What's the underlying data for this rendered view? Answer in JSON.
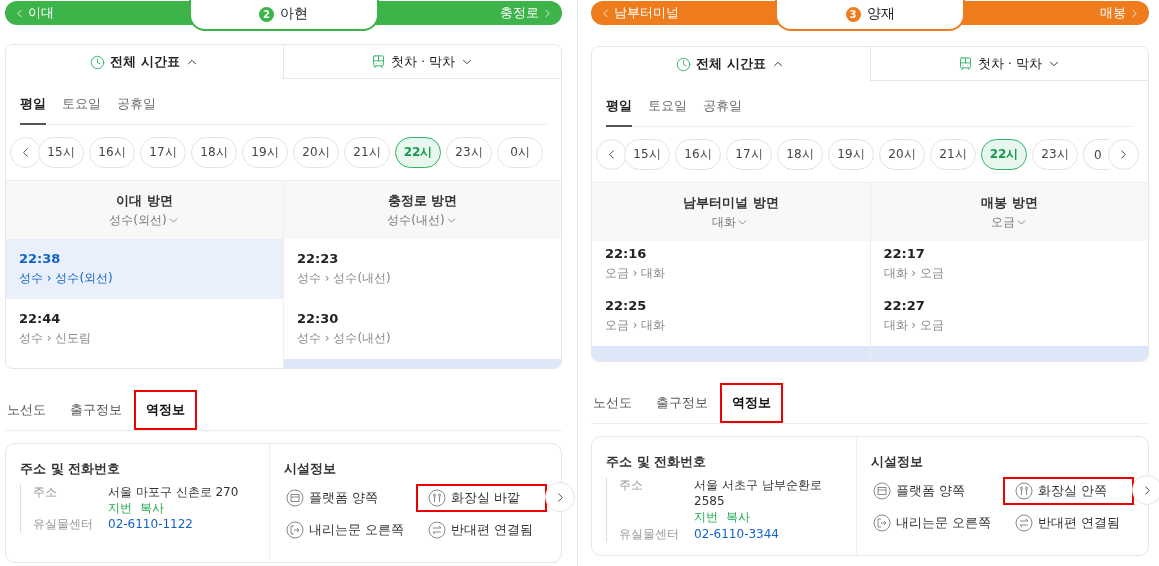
{
  "panels": [
    {
      "line": {
        "number": "2",
        "color": "#3cb44a",
        "prev": "이대",
        "current": "아현",
        "next": "충정로"
      },
      "view_tabs": [
        {
          "kind": "timetable",
          "label": "전체 시간표",
          "selected": true
        },
        {
          "kind": "first_last",
          "label": "첫차 · 막차",
          "selected": false
        }
      ],
      "day_tabs": [
        {
          "label": "평일",
          "selected": true
        },
        {
          "label": "토요일",
          "selected": false
        },
        {
          "label": "공휴일",
          "selected": false
        }
      ],
      "hours": [
        {
          "label": "15시",
          "selected": false
        },
        {
          "label": "16시",
          "selected": false
        },
        {
          "label": "17시",
          "selected": false
        },
        {
          "label": "18시",
          "selected": false
        },
        {
          "label": "19시",
          "selected": false
        },
        {
          "label": "20시",
          "selected": false
        },
        {
          "label": "21시",
          "selected": false
        },
        {
          "label": "22시",
          "selected": true
        },
        {
          "label": "23시",
          "selected": false
        },
        {
          "label": "0시",
          "selected": false
        }
      ],
      "scroll_next": false,
      "directions": [
        {
          "title": "이대 방면",
          "subtitle": "성수(외선)",
          "next_row_selected": false,
          "rows": [
            {
              "time": "22:38",
              "route": "성수 › 성수(외선)",
              "selected": true
            },
            {
              "time": "22:44",
              "route": "성수 › 신도림",
              "selected": false
            }
          ]
        },
        {
          "title": "충정로 방면",
          "subtitle": "성수(내선)",
          "next_row_selected": true,
          "rows": [
            {
              "time": "22:23",
              "route": "성수 › 성수(내선)",
              "selected": false
            },
            {
              "time": "22:30",
              "route": "성수 › 성수(내선)",
              "selected": false
            }
          ]
        }
      ],
      "info_tabs": [
        {
          "label": "노선도",
          "selected": false,
          "highlighted": false
        },
        {
          "label": "출구정보",
          "selected": false,
          "highlighted": false
        },
        {
          "label": "역정보",
          "selected": true,
          "highlighted": true
        }
      ],
      "address": {
        "title": "주소 및 전화번호",
        "address_label": "주소",
        "address": "서울 마포구 신촌로 270",
        "links": [
          "지번",
          "복사"
        ],
        "phone_label": "유실물센터",
        "phone": "02-6110-1122"
      },
      "facilities": {
        "title": "시설정보",
        "items": [
          {
            "kind": "platform",
            "label": "플랫폼 양쪽",
            "highlighted": false
          },
          {
            "kind": "toilet",
            "label": "화장실 바깥",
            "highlighted": true
          },
          {
            "kind": "door",
            "label": "내리는문 오른쪽",
            "highlighted": false
          },
          {
            "kind": "transfer",
            "label": "반대편 연결됨",
            "highlighted": false
          }
        ]
      }
    },
    {
      "line": {
        "number": "3",
        "color": "#ef7c1c",
        "prev": "남부터미널",
        "current": "양재",
        "next": "매봉"
      },
      "view_tabs": [
        {
          "kind": "timetable",
          "label": "전체 시간표",
          "selected": true
        },
        {
          "kind": "first_last",
          "label": "첫차 · 막차",
          "selected": false
        }
      ],
      "day_tabs": [
        {
          "label": "평일",
          "selected": true
        },
        {
          "label": "토요일",
          "selected": false
        },
        {
          "label": "공휴일",
          "selected": false
        }
      ],
      "hours": [
        {
          "label": "15시",
          "selected": false
        },
        {
          "label": "16시",
          "selected": false
        },
        {
          "label": "17시",
          "selected": false
        },
        {
          "label": "18시",
          "selected": false
        },
        {
          "label": "19시",
          "selected": false
        },
        {
          "label": "20시",
          "selected": false
        },
        {
          "label": "21시",
          "selected": false
        },
        {
          "label": "22시",
          "selected": true
        },
        {
          "label": "23시",
          "selected": false
        },
        {
          "label": "0",
          "selected": false
        }
      ],
      "scroll_next": true,
      "directions": [
        {
          "title": "남부터미널 방면",
          "subtitle": "대화",
          "next_row_selected": true,
          "rows": [
            {
              "time": "22:16",
              "route": "오금 › 대화",
              "selected": false
            },
            {
              "time": "22:25",
              "route": "오금 › 대화",
              "selected": false
            }
          ]
        },
        {
          "title": "매봉 방면",
          "subtitle": "오금",
          "next_row_selected": true,
          "rows": [
            {
              "time": "22:17",
              "route": "대화 › 오금",
              "selected": false
            },
            {
              "time": "22:27",
              "route": "대화 › 오금",
              "selected": false
            }
          ]
        }
      ],
      "info_tabs": [
        {
          "label": "노선도",
          "selected": false,
          "highlighted": false
        },
        {
          "label": "출구정보",
          "selected": false,
          "highlighted": false
        },
        {
          "label": "역정보",
          "selected": true,
          "highlighted": true
        }
      ],
      "address": {
        "title": "주소 및 전화번호",
        "address_label": "주소",
        "address": "서울 서초구 남부순환로 2585",
        "links": [
          "지번",
          "복사"
        ],
        "phone_label": "유실물센터",
        "phone": "02-6110-3344"
      },
      "facilities": {
        "title": "시설정보",
        "items": [
          {
            "kind": "platform",
            "label": "플랫폼 양쪽",
            "highlighted": false
          },
          {
            "kind": "toilet",
            "label": "화장실 안쪽",
            "highlighted": true
          },
          {
            "kind": "door",
            "label": "내리는문 오른쪽",
            "highlighted": false
          },
          {
            "kind": "transfer",
            "label": "반대편 연결됨",
            "highlighted": false
          }
        ]
      }
    }
  ]
}
